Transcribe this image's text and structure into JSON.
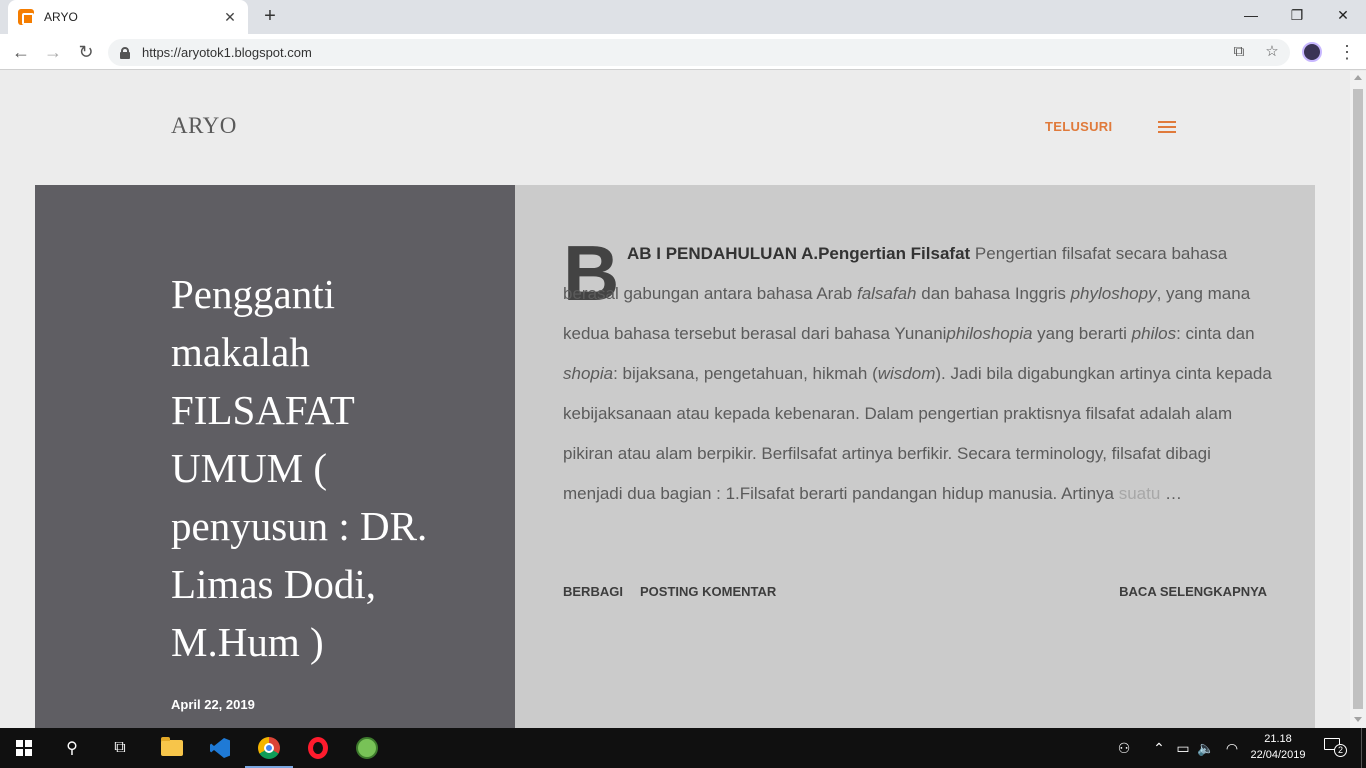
{
  "browser": {
    "tab_title": "ARYO",
    "tab_close": "✕",
    "new_tab": "+",
    "url": "https://aryotok1.blogspot.com",
    "back": "←",
    "forward": "→",
    "reload": "↻",
    "translate_icon": "⧉",
    "star_icon": "☆",
    "menu_icon": "⋮",
    "minimize": "—",
    "maximize": "❐",
    "close": "✕"
  },
  "blog": {
    "title": "ARYO",
    "search_label": "TELUSURI"
  },
  "post": {
    "title": "Pengganti makalah FILSAFAT UMUM ( penyusun : DR. Limas Dodi, M.Hum )",
    "date": "April 22, 2019",
    "dropcap": "B",
    "excerpt_bold": "AB I PENDAHULUAN A.Pengertian Filsafat",
    "excerpt_1": " Pengertian filsafat secara bahasa berasal gabungan antara bahasa Arab ",
    "italic_1": "falsafah",
    "excerpt_2": " dan bahasa Inggris ",
    "italic_2": "phyloshopy",
    "excerpt_3": ", yang mana kedua bahasa tersebut berasal dari bahasa Yunani",
    "italic_3": "philoshopia",
    "excerpt_4": " yang berarti ",
    "italic_4": "philos",
    "excerpt_5": ": cinta dan ",
    "italic_5": "shopia",
    "excerpt_6": ": bijaksana, pengetahuan, hikmah (",
    "italic_6": "wisdom",
    "excerpt_7": "). Jadi bila digabungkan artinya cinta kepada kebijaksanaan atau kepada kebenaran. Dalam pengertian praktisnya filsafat adalah alam pikiran atau alam berpikir. Berfilsafat artinya berfikir. Secara terminology, filsafat dibagi menjadi dua bagian : 1.Filsafat berarti pandangan hidup manusia. Artinya ",
    "excerpt_fade": "suatu",
    "ellipsis": " …",
    "share_label": "BERBAGI",
    "comment_label": "POSTING KOMENTAR",
    "readmore_label": "BACA SELENGKAPNYA"
  },
  "taskbar": {
    "time": "21.18",
    "date": "22/04/2019",
    "notification_count": "2",
    "search_icon": "⚲",
    "taskview_icon": "⧉",
    "people_icon": "⚇",
    "chevron_icon": "⌃",
    "battery_icon": "▭",
    "volume_icon": "🔈",
    "wifi_icon": "◠"
  }
}
